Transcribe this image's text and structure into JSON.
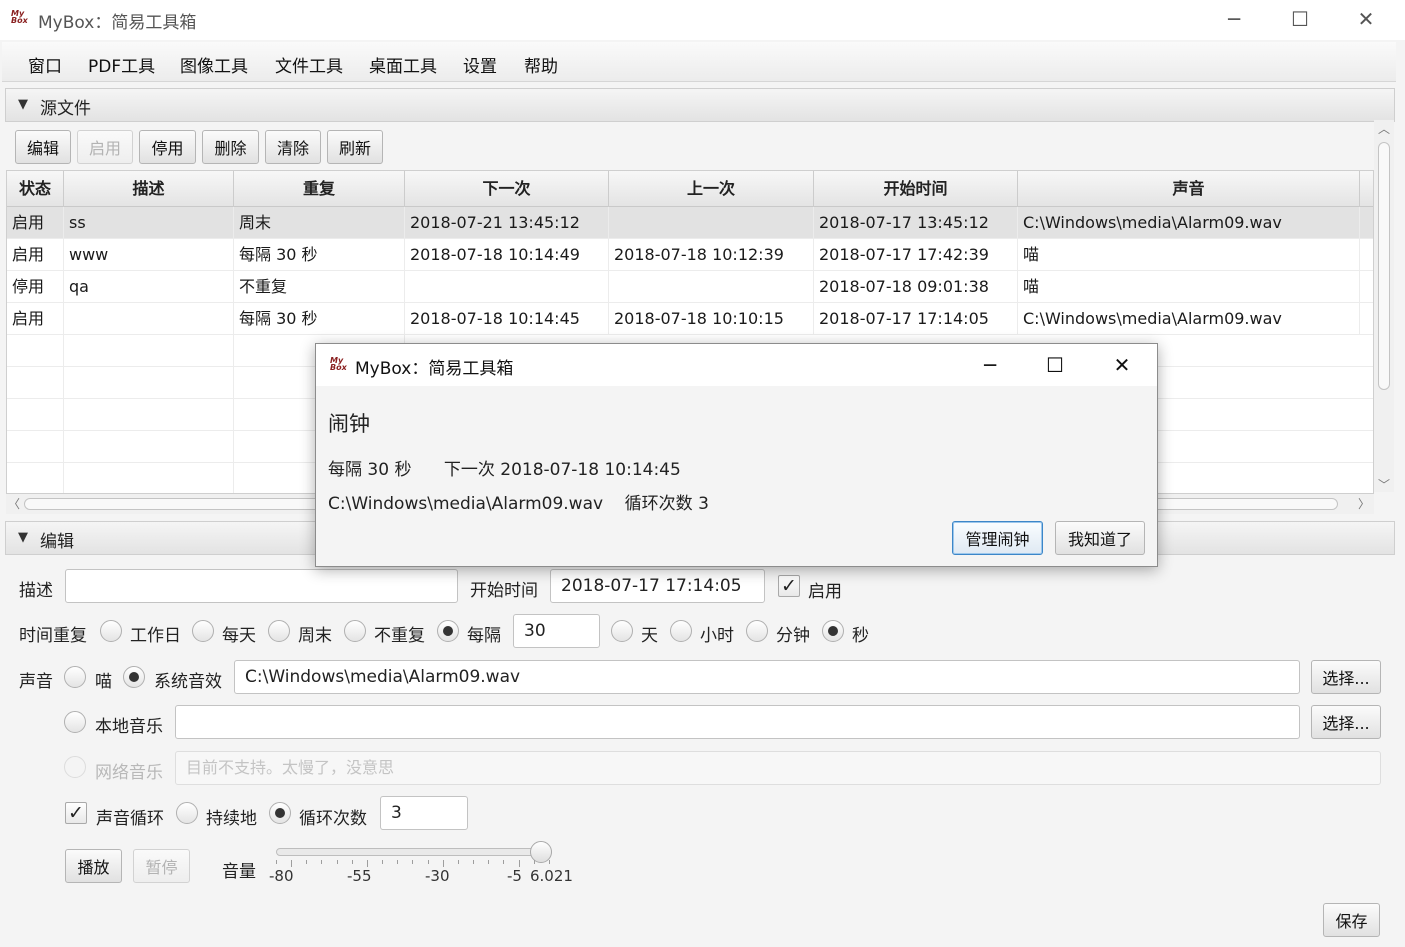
{
  "window": {
    "title": "MyBox：简易工具箱",
    "logo_text": "My Box",
    "minimize": "─",
    "maximize": "☐",
    "close": "✕"
  },
  "menu": [
    "窗口",
    "PDF工具",
    "图像工具",
    "文件工具",
    "桌面工具",
    "设置",
    "帮助"
  ],
  "source_section": {
    "title": "源文件",
    "toolbar": [
      {
        "label": "编辑",
        "enabled": true
      },
      {
        "label": "启用",
        "enabled": false
      },
      {
        "label": "停用",
        "enabled": true
      },
      {
        "label": "删除",
        "enabled": true
      },
      {
        "label": "清除",
        "enabled": true
      },
      {
        "label": "刷新",
        "enabled": true
      }
    ],
    "columns": [
      "状态",
      "描述",
      "重复",
      "下一次",
      "上一次",
      "开始时间",
      "声音"
    ],
    "rows": [
      [
        "启用",
        "ss",
        "周末",
        "2018-07-21 13:45:12",
        "",
        "2018-07-17 13:45:12",
        "C:\\Windows\\media\\Alarm09.wav"
      ],
      [
        "启用",
        "www",
        "每隔 30 秒",
        "2018-07-18 10:14:49",
        "2018-07-18 10:12:39",
        "2018-07-17 17:42:39",
        "喵"
      ],
      [
        "停用",
        "qa",
        "不重复",
        "",
        "",
        "2018-07-18 09:01:38",
        "喵"
      ],
      [
        "启用",
        "",
        "每隔 30 秒",
        "2018-07-18 10:14:45",
        "2018-07-18 10:10:15",
        "2018-07-17 17:14:05",
        "C:\\Windows\\media\\Alarm09.wav"
      ]
    ],
    "selected_row": 0
  },
  "edit_section": {
    "title": "编辑",
    "desc_label": "描述",
    "desc_value": "",
    "start_label": "开始时间",
    "start_value": "2018-07-17 17:14:05",
    "enabled_label": "启用",
    "enabled_checked": true,
    "repeat_label": "时间重复",
    "repeat_options": [
      "工作日",
      "每天",
      "周末",
      "不重复",
      "每隔"
    ],
    "repeat_selected": "每隔",
    "interval_value": "30",
    "unit_options": [
      "天",
      "小时",
      "分钟",
      "秒"
    ],
    "unit_selected": "秒",
    "sound_label": "声音",
    "sound_options": [
      "喵",
      "系统音效"
    ],
    "sound_selected": "系统音效",
    "system_sound_path": "C:\\Windows\\media\\Alarm09.wav",
    "choose_label": "选择...",
    "local_music_label": "本地音乐",
    "local_music_path": "",
    "net_music_label": "网络音乐",
    "net_music_placeholder": "目前不支持。太慢了，没意思",
    "loop_label": "声音循环",
    "loop_checked": true,
    "continuous_label": "持续地",
    "loop_times_label": "循环次数",
    "loop_mode_selected": "循环次数",
    "loop_times_value": "3",
    "play_label": "播放",
    "pause_label": "暂停",
    "volume_label": "音量",
    "volume_ticks": [
      "-80",
      "-55",
      "-30",
      "-5"
    ],
    "volume_value": "6.021",
    "volume_min": -85,
    "volume_max": 6.021,
    "save_label": "保存"
  },
  "dialog": {
    "title": "MyBox：简易工具箱",
    "heading": "闹钟",
    "line1": "每隔 30 秒      下一次 2018-07-18 10:14:45",
    "line2": "C:\\Windows\\media\\Alarm09.wav    循环次数 3",
    "manage_label": "管理闹钟",
    "ok_label": "我知道了"
  }
}
